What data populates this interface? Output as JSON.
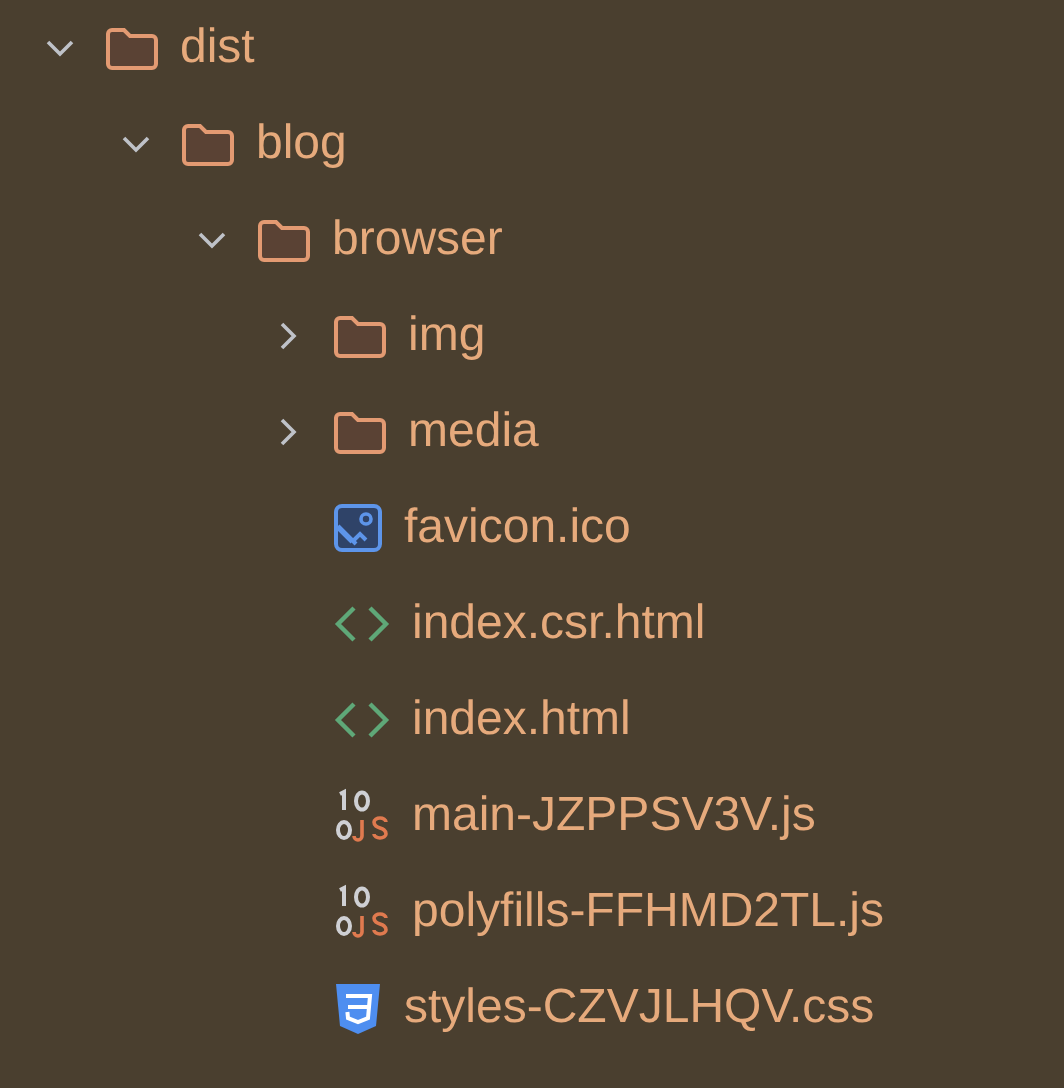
{
  "tree": [
    {
      "kind": "folder",
      "name": "dist",
      "expanded": true,
      "children": [
        {
          "kind": "folder",
          "name": "blog",
          "expanded": true,
          "children": [
            {
              "kind": "folder",
              "name": "browser",
              "expanded": true,
              "children": [
                {
                  "kind": "folder",
                  "name": "img",
                  "expanded": false
                },
                {
                  "kind": "folder",
                  "name": "media",
                  "expanded": false
                },
                {
                  "kind": "image",
                  "name": "favicon.ico"
                },
                {
                  "kind": "html",
                  "name": "index.csr.html"
                },
                {
                  "kind": "html",
                  "name": "index.html"
                },
                {
                  "kind": "js",
                  "name": "main-JZPPSV3V.js"
                },
                {
                  "kind": "js",
                  "name": "polyfills-FFHMD2TL.js"
                },
                {
                  "kind": "css",
                  "name": "styles-CZVJLHQV.css"
                }
              ]
            }
          ]
        }
      ]
    }
  ]
}
